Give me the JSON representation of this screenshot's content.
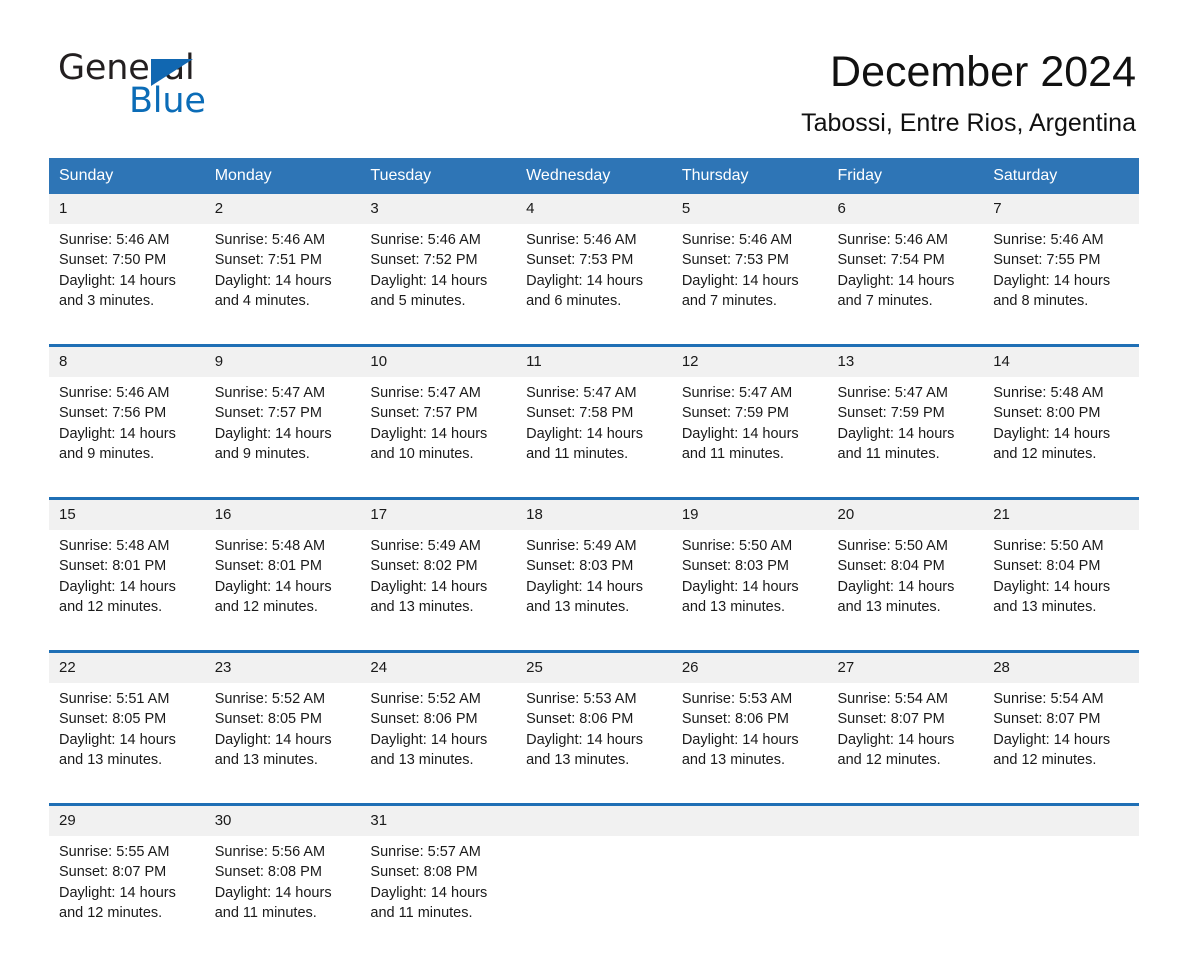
{
  "brand": {
    "name_part1": "General",
    "name_part2": "Blue",
    "triangle_color": "#1167b1",
    "blue_color": "#0b6cb7"
  },
  "header": {
    "title": "December 2024",
    "subtitle": "Tabossi, Entre Rios, Argentina"
  },
  "theme": {
    "header_blue": "#2e75b6",
    "rule_blue": "#1f6fb5",
    "daynum_gray": "#f1f1f1"
  },
  "weekdays": [
    "Sunday",
    "Monday",
    "Tuesday",
    "Wednesday",
    "Thursday",
    "Friday",
    "Saturday"
  ],
  "weeks": [
    [
      {
        "day": "1",
        "sunrise": "Sunrise: 5:46 AM",
        "sunset": "Sunset: 7:50 PM",
        "daylight_a": "Daylight: 14 hours",
        "daylight_b": "and 3 minutes."
      },
      {
        "day": "2",
        "sunrise": "Sunrise: 5:46 AM",
        "sunset": "Sunset: 7:51 PM",
        "daylight_a": "Daylight: 14 hours",
        "daylight_b": "and 4 minutes."
      },
      {
        "day": "3",
        "sunrise": "Sunrise: 5:46 AM",
        "sunset": "Sunset: 7:52 PM",
        "daylight_a": "Daylight: 14 hours",
        "daylight_b": "and 5 minutes."
      },
      {
        "day": "4",
        "sunrise": "Sunrise: 5:46 AM",
        "sunset": "Sunset: 7:53 PM",
        "daylight_a": "Daylight: 14 hours",
        "daylight_b": "and 6 minutes."
      },
      {
        "day": "5",
        "sunrise": "Sunrise: 5:46 AM",
        "sunset": "Sunset: 7:53 PM",
        "daylight_a": "Daylight: 14 hours",
        "daylight_b": "and 7 minutes."
      },
      {
        "day": "6",
        "sunrise": "Sunrise: 5:46 AM",
        "sunset": "Sunset: 7:54 PM",
        "daylight_a": "Daylight: 14 hours",
        "daylight_b": "and 7 minutes."
      },
      {
        "day": "7",
        "sunrise": "Sunrise: 5:46 AM",
        "sunset": "Sunset: 7:55 PM",
        "daylight_a": "Daylight: 14 hours",
        "daylight_b": "and 8 minutes."
      }
    ],
    [
      {
        "day": "8",
        "sunrise": "Sunrise: 5:46 AM",
        "sunset": "Sunset: 7:56 PM",
        "daylight_a": "Daylight: 14 hours",
        "daylight_b": "and 9 minutes."
      },
      {
        "day": "9",
        "sunrise": "Sunrise: 5:47 AM",
        "sunset": "Sunset: 7:57 PM",
        "daylight_a": "Daylight: 14 hours",
        "daylight_b": "and 9 minutes."
      },
      {
        "day": "10",
        "sunrise": "Sunrise: 5:47 AM",
        "sunset": "Sunset: 7:57 PM",
        "daylight_a": "Daylight: 14 hours",
        "daylight_b": "and 10 minutes."
      },
      {
        "day": "11",
        "sunrise": "Sunrise: 5:47 AM",
        "sunset": "Sunset: 7:58 PM",
        "daylight_a": "Daylight: 14 hours",
        "daylight_b": "and 11 minutes."
      },
      {
        "day": "12",
        "sunrise": "Sunrise: 5:47 AM",
        "sunset": "Sunset: 7:59 PM",
        "daylight_a": "Daylight: 14 hours",
        "daylight_b": "and 11 minutes."
      },
      {
        "day": "13",
        "sunrise": "Sunrise: 5:47 AM",
        "sunset": "Sunset: 7:59 PM",
        "daylight_a": "Daylight: 14 hours",
        "daylight_b": "and 11 minutes."
      },
      {
        "day": "14",
        "sunrise": "Sunrise: 5:48 AM",
        "sunset": "Sunset: 8:00 PM",
        "daylight_a": "Daylight: 14 hours",
        "daylight_b": "and 12 minutes."
      }
    ],
    [
      {
        "day": "15",
        "sunrise": "Sunrise: 5:48 AM",
        "sunset": "Sunset: 8:01 PM",
        "daylight_a": "Daylight: 14 hours",
        "daylight_b": "and 12 minutes."
      },
      {
        "day": "16",
        "sunrise": "Sunrise: 5:48 AM",
        "sunset": "Sunset: 8:01 PM",
        "daylight_a": "Daylight: 14 hours",
        "daylight_b": "and 12 minutes."
      },
      {
        "day": "17",
        "sunrise": "Sunrise: 5:49 AM",
        "sunset": "Sunset: 8:02 PM",
        "daylight_a": "Daylight: 14 hours",
        "daylight_b": "and 13 minutes."
      },
      {
        "day": "18",
        "sunrise": "Sunrise: 5:49 AM",
        "sunset": "Sunset: 8:03 PM",
        "daylight_a": "Daylight: 14 hours",
        "daylight_b": "and 13 minutes."
      },
      {
        "day": "19",
        "sunrise": "Sunrise: 5:50 AM",
        "sunset": "Sunset: 8:03 PM",
        "daylight_a": "Daylight: 14 hours",
        "daylight_b": "and 13 minutes."
      },
      {
        "day": "20",
        "sunrise": "Sunrise: 5:50 AM",
        "sunset": "Sunset: 8:04 PM",
        "daylight_a": "Daylight: 14 hours",
        "daylight_b": "and 13 minutes."
      },
      {
        "day": "21",
        "sunrise": "Sunrise: 5:50 AM",
        "sunset": "Sunset: 8:04 PM",
        "daylight_a": "Daylight: 14 hours",
        "daylight_b": "and 13 minutes."
      }
    ],
    [
      {
        "day": "22",
        "sunrise": "Sunrise: 5:51 AM",
        "sunset": "Sunset: 8:05 PM",
        "daylight_a": "Daylight: 14 hours",
        "daylight_b": "and 13 minutes."
      },
      {
        "day": "23",
        "sunrise": "Sunrise: 5:52 AM",
        "sunset": "Sunset: 8:05 PM",
        "daylight_a": "Daylight: 14 hours",
        "daylight_b": "and 13 minutes."
      },
      {
        "day": "24",
        "sunrise": "Sunrise: 5:52 AM",
        "sunset": "Sunset: 8:06 PM",
        "daylight_a": "Daylight: 14 hours",
        "daylight_b": "and 13 minutes."
      },
      {
        "day": "25",
        "sunrise": "Sunrise: 5:53 AM",
        "sunset": "Sunset: 8:06 PM",
        "daylight_a": "Daylight: 14 hours",
        "daylight_b": "and 13 minutes."
      },
      {
        "day": "26",
        "sunrise": "Sunrise: 5:53 AM",
        "sunset": "Sunset: 8:06 PM",
        "daylight_a": "Daylight: 14 hours",
        "daylight_b": "and 13 minutes."
      },
      {
        "day": "27",
        "sunrise": "Sunrise: 5:54 AM",
        "sunset": "Sunset: 8:07 PM",
        "daylight_a": "Daylight: 14 hours",
        "daylight_b": "and 12 minutes."
      },
      {
        "day": "28",
        "sunrise": "Sunrise: 5:54 AM",
        "sunset": "Sunset: 8:07 PM",
        "daylight_a": "Daylight: 14 hours",
        "daylight_b": "and 12 minutes."
      }
    ],
    [
      {
        "day": "29",
        "sunrise": "Sunrise: 5:55 AM",
        "sunset": "Sunset: 8:07 PM",
        "daylight_a": "Daylight: 14 hours",
        "daylight_b": "and 12 minutes."
      },
      {
        "day": "30",
        "sunrise": "Sunrise: 5:56 AM",
        "sunset": "Sunset: 8:08 PM",
        "daylight_a": "Daylight: 14 hours",
        "daylight_b": "and 11 minutes."
      },
      {
        "day": "31",
        "sunrise": "Sunrise: 5:57 AM",
        "sunset": "Sunset: 8:08 PM",
        "daylight_a": "Daylight: 14 hours",
        "daylight_b": "and 11 minutes."
      },
      {
        "day": "",
        "sunrise": "",
        "sunset": "",
        "daylight_a": "",
        "daylight_b": ""
      },
      {
        "day": "",
        "sunrise": "",
        "sunset": "",
        "daylight_a": "",
        "daylight_b": ""
      },
      {
        "day": "",
        "sunrise": "",
        "sunset": "",
        "daylight_a": "",
        "daylight_b": ""
      },
      {
        "day": "",
        "sunrise": "",
        "sunset": "",
        "daylight_a": "",
        "daylight_b": ""
      }
    ]
  ]
}
